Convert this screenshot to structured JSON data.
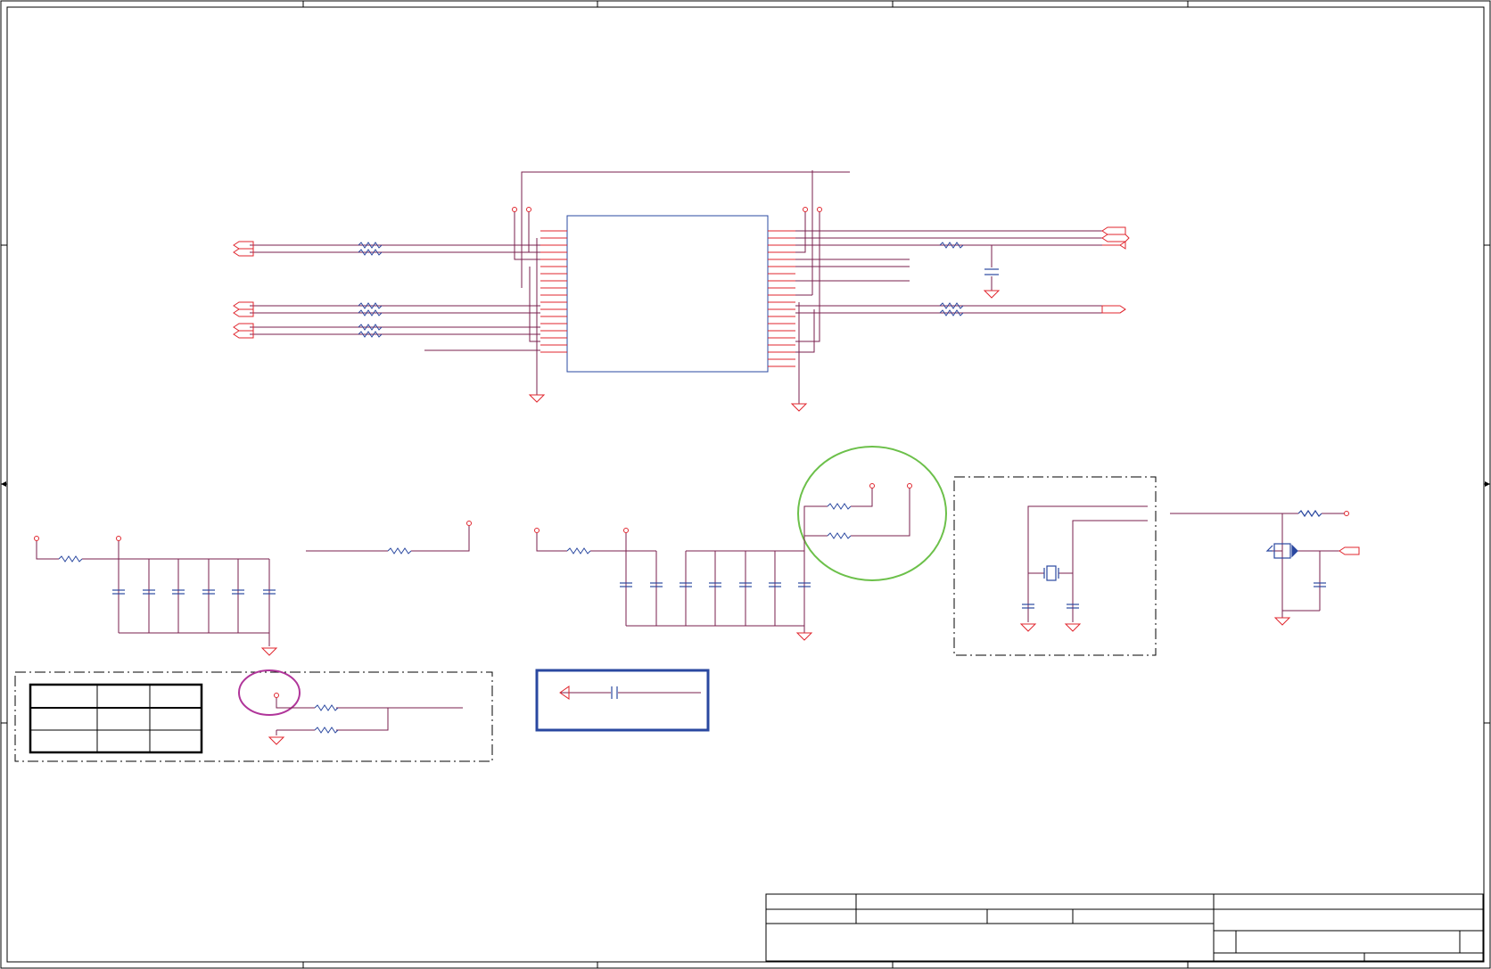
{
  "colors": {
    "frame": "#000000",
    "wire": "#7a1f4e",
    "pin": "#e0262e",
    "component": "#2a48a0",
    "highlight_green": "#6cc04a",
    "highlight_magenta": "#b0359a",
    "box_blue": "#2a48a0"
  },
  "sheet": {
    "texts": []
  }
}
